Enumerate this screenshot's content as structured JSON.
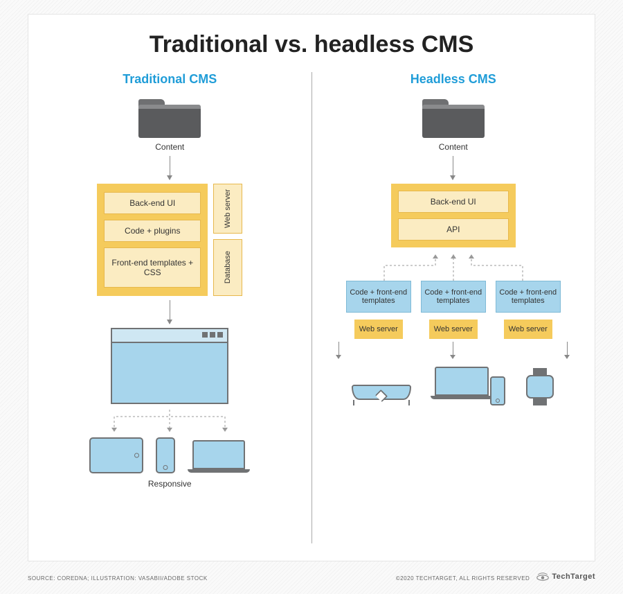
{
  "title": "Traditional vs. headless CMS",
  "traditional": {
    "heading": "Traditional CMS",
    "content_label": "Content",
    "stack": {
      "backend": "Back-end UI",
      "code": "Code + plugins",
      "frontend": "Front-end templates + CSS"
    },
    "side": {
      "webserver": "Web server",
      "database": "Database"
    },
    "responsive_label": "Responsive"
  },
  "headless": {
    "heading": "Headless CMS",
    "content_label": "Content",
    "stack": {
      "backend": "Back-end UI",
      "api": "API"
    },
    "frontend_box": "Code + front-end templates",
    "webserver": "Web server"
  },
  "footer": {
    "source": "SOURCE: COREDNA; ILLUSTRATION: VASABII/ADOBE STOCK",
    "copyright": "©2020 TECHTARGET, ALL RIGHTS RESERVED",
    "brand": "TechTarget"
  }
}
